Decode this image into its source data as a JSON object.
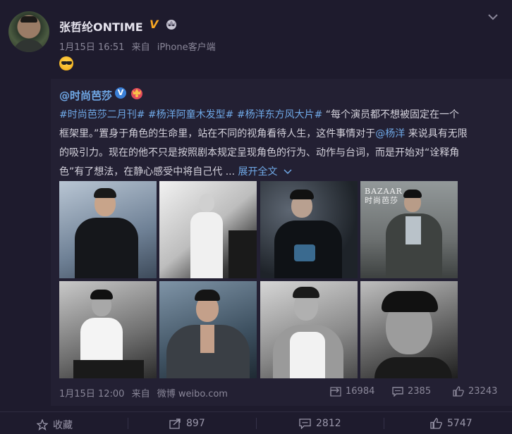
{
  "post": {
    "username": "张哲纶ONTIME",
    "verified_badge": "V",
    "date": "1月15日 16:51",
    "source_prefix": "来自",
    "source": "iPhone客户端",
    "emoji": "cool-face"
  },
  "repost": {
    "author": "@时尚芭莎",
    "verified_mark": "V",
    "tag1": "#时尚芭莎二月刊#",
    "tag2": "#杨洋阿童木发型#",
    "tag3": "#杨洋东方风大片#",
    "text1": " “每个演员都不想被固定在一个框架里。”置身于角色的生命里，站在不同的视角看待人生，这件事情对于",
    "mention": "@杨洋",
    "text2": " 来说具有无限的吸引力。现在的他不只是按照剧本规定呈现角色的行为、动作与台词，而是开始对“诠释角色”有了想法，在静心感受中将自己代 ... ",
    "more": "展开全文",
    "magazine_line1": "BAZAAR",
    "magazine_line2": "时尚芭莎",
    "date": "1月15日 12:00",
    "source_prefix": "来自",
    "source": "微博 weibo.com",
    "forwards": "16984",
    "comments": "2385",
    "likes": "23243"
  },
  "actions": {
    "favorite": "收藏",
    "forward": "897",
    "comment": "2812",
    "like": "5747"
  },
  "colors": {
    "background": "#1e1b2d",
    "repost_background": "#232033",
    "link": "#6fa8e6",
    "verified_gold": "#f5a623"
  }
}
